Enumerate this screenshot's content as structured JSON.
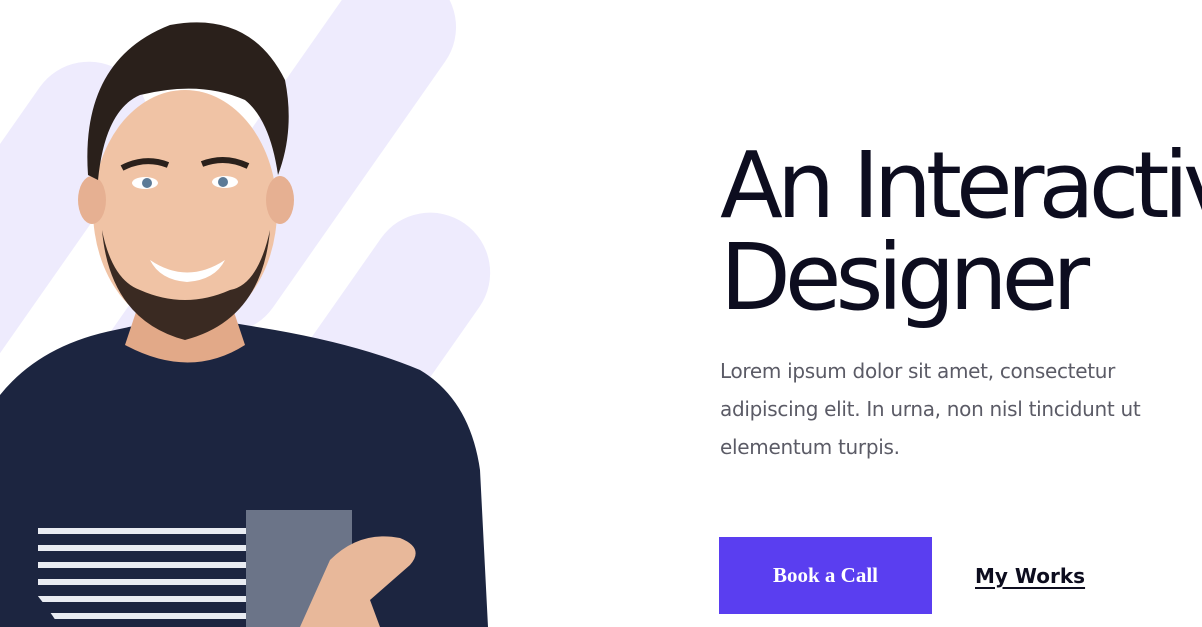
{
  "hero": {
    "title_line1": "An Interactive",
    "title_line2": "Designer",
    "description": "Lorem ipsum dolor sit amet, consectetur adipiscing elit. In urna, non nisl tincidunt ut elementum turpis.",
    "primary_button_label": "Book a Call",
    "secondary_link_label": "My Works"
  },
  "colors": {
    "accent": "#5a3ef0",
    "heading": "#0d0d1f",
    "body_text": "#5b5b66",
    "decor_stripes": "#eeebfd",
    "shirt": "#1c2540"
  },
  "icons": {
    "hero_image": "portrait-photo"
  }
}
